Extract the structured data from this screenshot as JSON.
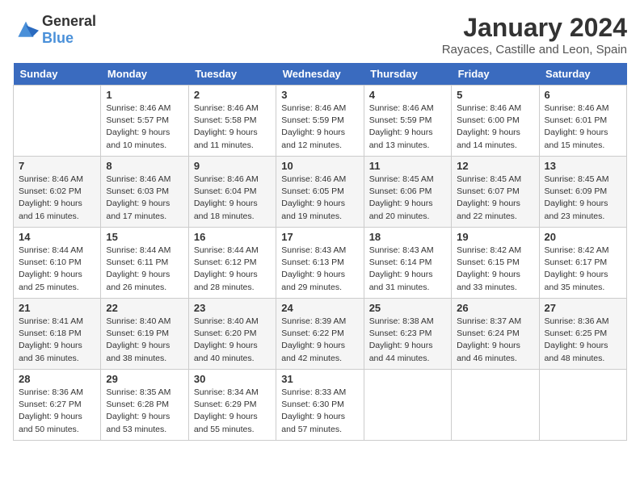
{
  "logo": {
    "text_general": "General",
    "text_blue": "Blue"
  },
  "title": "January 2024",
  "subtitle": "Rayaces, Castille and Leon, Spain",
  "days": [
    "Sunday",
    "Monday",
    "Tuesday",
    "Wednesday",
    "Thursday",
    "Friday",
    "Saturday"
  ],
  "weeks": [
    [
      {
        "date": "",
        "sunrise": "",
        "sunset": "",
        "daylight": ""
      },
      {
        "date": "1",
        "sunrise": "Sunrise: 8:46 AM",
        "sunset": "Sunset: 5:57 PM",
        "daylight": "Daylight: 9 hours and 10 minutes."
      },
      {
        "date": "2",
        "sunrise": "Sunrise: 8:46 AM",
        "sunset": "Sunset: 5:58 PM",
        "daylight": "Daylight: 9 hours and 11 minutes."
      },
      {
        "date": "3",
        "sunrise": "Sunrise: 8:46 AM",
        "sunset": "Sunset: 5:59 PM",
        "daylight": "Daylight: 9 hours and 12 minutes."
      },
      {
        "date": "4",
        "sunrise": "Sunrise: 8:46 AM",
        "sunset": "Sunset: 5:59 PM",
        "daylight": "Daylight: 9 hours and 13 minutes."
      },
      {
        "date": "5",
        "sunrise": "Sunrise: 8:46 AM",
        "sunset": "Sunset: 6:00 PM",
        "daylight": "Daylight: 9 hours and 14 minutes."
      },
      {
        "date": "6",
        "sunrise": "Sunrise: 8:46 AM",
        "sunset": "Sunset: 6:01 PM",
        "daylight": "Daylight: 9 hours and 15 minutes."
      }
    ],
    [
      {
        "date": "7",
        "sunrise": "Sunrise: 8:46 AM",
        "sunset": "Sunset: 6:02 PM",
        "daylight": "Daylight: 9 hours and 16 minutes."
      },
      {
        "date": "8",
        "sunrise": "Sunrise: 8:46 AM",
        "sunset": "Sunset: 6:03 PM",
        "daylight": "Daylight: 9 hours and 17 minutes."
      },
      {
        "date": "9",
        "sunrise": "Sunrise: 8:46 AM",
        "sunset": "Sunset: 6:04 PM",
        "daylight": "Daylight: 9 hours and 18 minutes."
      },
      {
        "date": "10",
        "sunrise": "Sunrise: 8:46 AM",
        "sunset": "Sunset: 6:05 PM",
        "daylight": "Daylight: 9 hours and 19 minutes."
      },
      {
        "date": "11",
        "sunrise": "Sunrise: 8:45 AM",
        "sunset": "Sunset: 6:06 PM",
        "daylight": "Daylight: 9 hours and 20 minutes."
      },
      {
        "date": "12",
        "sunrise": "Sunrise: 8:45 AM",
        "sunset": "Sunset: 6:07 PM",
        "daylight": "Daylight: 9 hours and 22 minutes."
      },
      {
        "date": "13",
        "sunrise": "Sunrise: 8:45 AM",
        "sunset": "Sunset: 6:09 PM",
        "daylight": "Daylight: 9 hours and 23 minutes."
      }
    ],
    [
      {
        "date": "14",
        "sunrise": "Sunrise: 8:44 AM",
        "sunset": "Sunset: 6:10 PM",
        "daylight": "Daylight: 9 hours and 25 minutes."
      },
      {
        "date": "15",
        "sunrise": "Sunrise: 8:44 AM",
        "sunset": "Sunset: 6:11 PM",
        "daylight": "Daylight: 9 hours and 26 minutes."
      },
      {
        "date": "16",
        "sunrise": "Sunrise: 8:44 AM",
        "sunset": "Sunset: 6:12 PM",
        "daylight": "Daylight: 9 hours and 28 minutes."
      },
      {
        "date": "17",
        "sunrise": "Sunrise: 8:43 AM",
        "sunset": "Sunset: 6:13 PM",
        "daylight": "Daylight: 9 hours and 29 minutes."
      },
      {
        "date": "18",
        "sunrise": "Sunrise: 8:43 AM",
        "sunset": "Sunset: 6:14 PM",
        "daylight": "Daylight: 9 hours and 31 minutes."
      },
      {
        "date": "19",
        "sunrise": "Sunrise: 8:42 AM",
        "sunset": "Sunset: 6:15 PM",
        "daylight": "Daylight: 9 hours and 33 minutes."
      },
      {
        "date": "20",
        "sunrise": "Sunrise: 8:42 AM",
        "sunset": "Sunset: 6:17 PM",
        "daylight": "Daylight: 9 hours and 35 minutes."
      }
    ],
    [
      {
        "date": "21",
        "sunrise": "Sunrise: 8:41 AM",
        "sunset": "Sunset: 6:18 PM",
        "daylight": "Daylight: 9 hours and 36 minutes."
      },
      {
        "date": "22",
        "sunrise": "Sunrise: 8:40 AM",
        "sunset": "Sunset: 6:19 PM",
        "daylight": "Daylight: 9 hours and 38 minutes."
      },
      {
        "date": "23",
        "sunrise": "Sunrise: 8:40 AM",
        "sunset": "Sunset: 6:20 PM",
        "daylight": "Daylight: 9 hours and 40 minutes."
      },
      {
        "date": "24",
        "sunrise": "Sunrise: 8:39 AM",
        "sunset": "Sunset: 6:22 PM",
        "daylight": "Daylight: 9 hours and 42 minutes."
      },
      {
        "date": "25",
        "sunrise": "Sunrise: 8:38 AM",
        "sunset": "Sunset: 6:23 PM",
        "daylight": "Daylight: 9 hours and 44 minutes."
      },
      {
        "date": "26",
        "sunrise": "Sunrise: 8:37 AM",
        "sunset": "Sunset: 6:24 PM",
        "daylight": "Daylight: 9 hours and 46 minutes."
      },
      {
        "date": "27",
        "sunrise": "Sunrise: 8:36 AM",
        "sunset": "Sunset: 6:25 PM",
        "daylight": "Daylight: 9 hours and 48 minutes."
      }
    ],
    [
      {
        "date": "28",
        "sunrise": "Sunrise: 8:36 AM",
        "sunset": "Sunset: 6:27 PM",
        "daylight": "Daylight: 9 hours and 50 minutes."
      },
      {
        "date": "29",
        "sunrise": "Sunrise: 8:35 AM",
        "sunset": "Sunset: 6:28 PM",
        "daylight": "Daylight: 9 hours and 53 minutes."
      },
      {
        "date": "30",
        "sunrise": "Sunrise: 8:34 AM",
        "sunset": "Sunset: 6:29 PM",
        "daylight": "Daylight: 9 hours and 55 minutes."
      },
      {
        "date": "31",
        "sunrise": "Sunrise: 8:33 AM",
        "sunset": "Sunset: 6:30 PM",
        "daylight": "Daylight: 9 hours and 57 minutes."
      },
      {
        "date": "",
        "sunrise": "",
        "sunset": "",
        "daylight": ""
      },
      {
        "date": "",
        "sunrise": "",
        "sunset": "",
        "daylight": ""
      },
      {
        "date": "",
        "sunrise": "",
        "sunset": "",
        "daylight": ""
      }
    ]
  ]
}
